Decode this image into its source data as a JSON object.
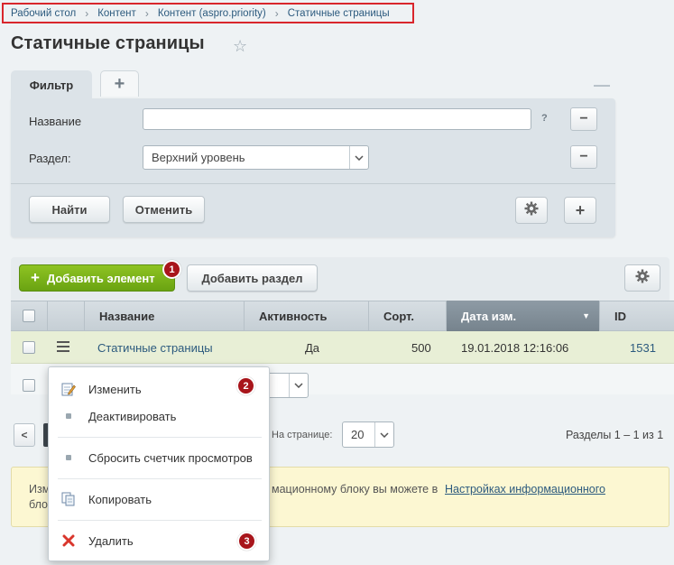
{
  "breadcrumb": {
    "items": [
      "Рабочий стол",
      "Контент",
      "Контент (aspro.priority)",
      "Статичные страницы"
    ],
    "sep": "›"
  },
  "page": {
    "title": "Статичные страницы",
    "star_glyph": "☆"
  },
  "filter": {
    "tab_label": "Фильтр",
    "add_tab_glyph": "+",
    "collapse_glyph": "—",
    "name_label": "Название",
    "name_value": "",
    "help_glyph": "?",
    "section_label": "Раздел:",
    "section_value": "Верхний уровень",
    "remove_glyph": "−",
    "find_label": "Найти",
    "cancel_label": "Отменить",
    "add_glyph": "+"
  },
  "toolbar": {
    "add_element_label": "Добавить элемент",
    "add_element_glyph": "+",
    "add_section_label": "Добавить раздел",
    "badge1": "1"
  },
  "table": {
    "columns": [
      "Название",
      "Активность",
      "Сорт.",
      "Дата изм.",
      "ID"
    ],
    "sorted_glyph": "▼",
    "row": {
      "name": "Статичные страницы",
      "active": "Да",
      "sort": "500",
      "date": "19.01.2018 12:16:06",
      "id": "1531"
    }
  },
  "pagination": {
    "prev_glyph": "<",
    "per_page_label": "На странице:",
    "per_page_value": "20",
    "summary": "Разделы 1 – 1 из 1"
  },
  "notice": {
    "text_left_1": "Изм",
    "text_left_2": "бло",
    "text_mid": "мационному блоку вы можете в",
    "link_text": "Настройках информационного"
  },
  "context_menu": {
    "edit_label": "Изменить",
    "edit_badge": "2",
    "deactivate_label": "Деактивировать",
    "reset_label": "Сбросить счетчик просмотров",
    "copy_label": "Копировать",
    "delete_label": "Удалить",
    "delete_badge": "3"
  },
  "colors": {
    "accent_green": "#7ab51d",
    "badge_red": "#a8151b",
    "highlight_red": "#d9262c",
    "link_blue": "#2c5a7e"
  }
}
